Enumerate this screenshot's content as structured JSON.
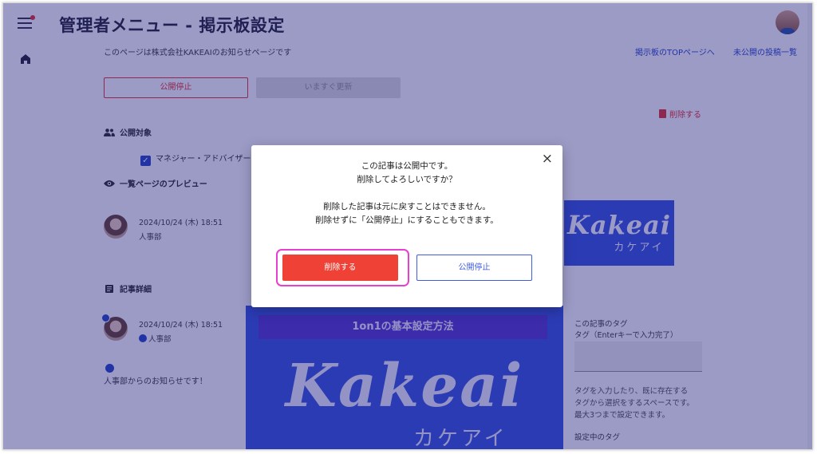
{
  "header": {
    "title": "管理者メニュー - 掲示板設定",
    "description": "このページは株式会社KAKEAIのお知らせページです",
    "link_top": "掲示板のTOPページへ",
    "link_unpublished": "未公開の投稿一覧"
  },
  "actions": {
    "unpublish_label": "公開停止",
    "update_label": "いますぐ更新",
    "delete_label": "削除する"
  },
  "sections": {
    "target_label": "公開対象",
    "target_option": "マネジャー・アドバイザー",
    "preview_label": "一覧ページのプレビュー",
    "detail_label": "記事詳細"
  },
  "post": {
    "date": "2024/10/24 (木) 18:51",
    "department": "人事部",
    "intro": "人事部からのお知らせです！"
  },
  "images": {
    "logo_text": "Kakeai",
    "logo_kana": "カケアイ",
    "hero_title": "1on1の基本設定方法"
  },
  "tags": {
    "label": "この記事のタグ",
    "input_hint": "タグ（Enterキーで入力完了）",
    "help_line1": "タグを入力したり、既に存在する",
    "help_line2": "タグから選択をするスペースです。",
    "help_line3": "最大3つまで設定できます。",
    "current_label": "設定中のタグ"
  },
  "modal": {
    "line1": "この記事は公開中です。",
    "line2": "削除してよろしいですか？",
    "line3": "削除した記事は元に戻すことはできません。",
    "line4": "削除せずに「公開停止」にすることもできます。",
    "delete_button": "削除する",
    "unpublish_button": "公開停止",
    "close": "×"
  },
  "colors": {
    "accent": "#3d5ae0",
    "danger": "#ef4136",
    "highlight": "#e83fd0"
  }
}
